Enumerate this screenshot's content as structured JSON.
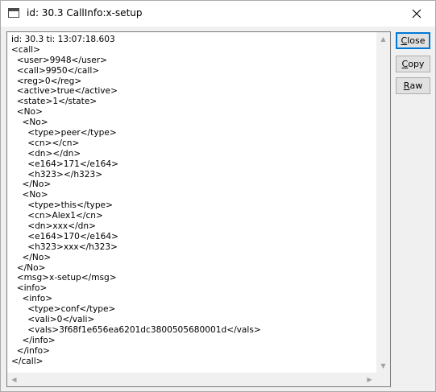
{
  "window": {
    "title": "id: 30.3 CallInfo:x-setup",
    "icons": {
      "app": "window-app-icon",
      "close": "close-x-icon"
    }
  },
  "buttons": {
    "close": {
      "label_first": "C",
      "label_rest": "lose"
    },
    "copy": {
      "label_first": "C",
      "label_rest": "opy"
    },
    "raw": {
      "label_first": "R",
      "label_rest": "aw"
    }
  },
  "text": {
    "lines": [
      "id: 30.3 ti: 13:07:18.603",
      "<call>",
      "  <user>9948</user>",
      "  <call>9950</call>",
      "  <reg>0</reg>",
      "  <active>true</active>",
      "  <state>1</state>",
      "  <No>",
      "    <No>",
      "      <type>peer</type>",
      "      <cn></cn>",
      "      <dn></dn>",
      "      <e164>171</e164>",
      "      <h323></h323>",
      "    </No>",
      "    <No>",
      "      <type>this</type>",
      "      <cn>Alex1</cn>",
      "      <dn>xxx</dn>",
      "      <e164>170</e164>",
      "      <h323>xxx</h323>",
      "    </No>",
      "  </No>",
      "  <msg>x-setup</msg>",
      "  <info>",
      "    <info>",
      "      <type>conf</type>",
      "      <vali>0</vali>",
      "      <vals>3f68f1e656ea6201dc3800505680001d</vals>",
      "    </info>",
      "  </info>",
      "</call>"
    ]
  }
}
